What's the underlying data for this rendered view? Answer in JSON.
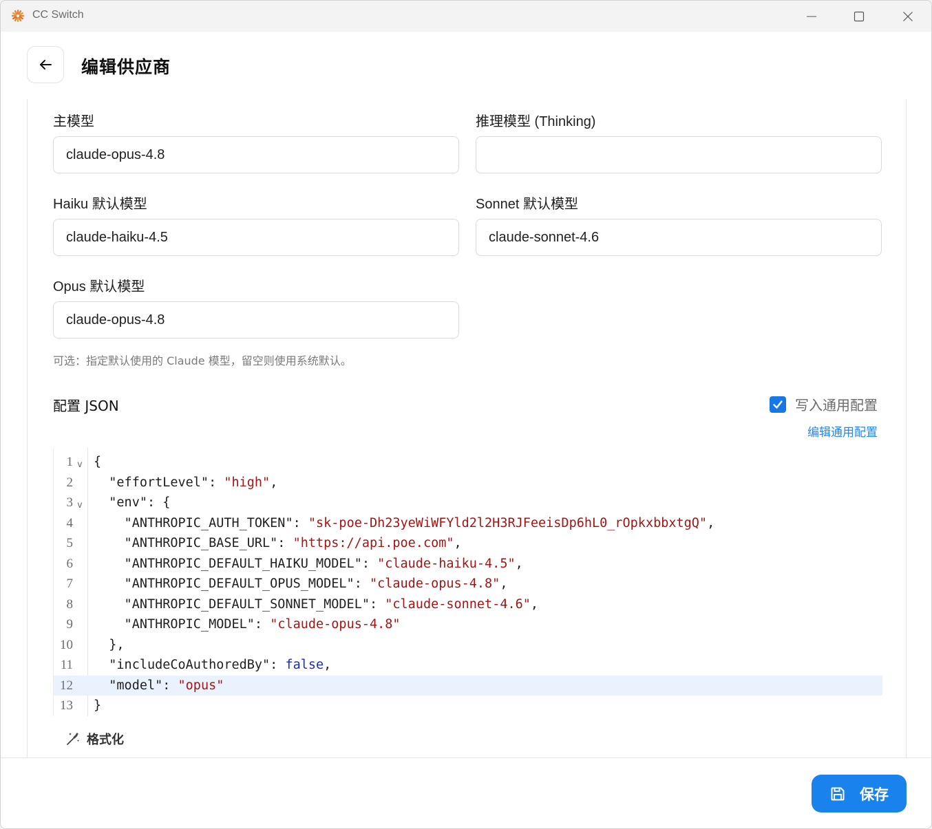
{
  "window": {
    "title": "CC Switch",
    "logo_icon": "cc-switch-logo",
    "accent": "#1a82ed"
  },
  "header": {
    "title": "编辑供应商",
    "back_icon": "arrow-left-icon"
  },
  "form": {
    "main_model": {
      "label": "主模型",
      "value": "claude-opus-4.8"
    },
    "thinking_model": {
      "label": "推理模型 (Thinking)",
      "value": ""
    },
    "haiku_model": {
      "label": "Haiku 默认模型",
      "value": "claude-haiku-4.5"
    },
    "sonnet_model": {
      "label": "Sonnet 默认模型",
      "value": "claude-sonnet-4.6"
    },
    "opus_model": {
      "label": "Opus 默认模型",
      "value": "claude-opus-4.8"
    },
    "hint": "可选：指定默认使用的 Claude 模型，留空则使用系统默认。"
  },
  "json_config": {
    "label": "配置 JSON",
    "write_common_label": "写入通用配置",
    "write_common_checked": true,
    "edit_common_link": "编辑通用配置",
    "format_label": "格式化",
    "lines": [
      {
        "n": "1",
        "tokens": [
          [
            "k",
            "{"
          ]
        ],
        "fold": true
      },
      {
        "n": "2",
        "tokens": [
          [
            "k",
            "  \"effortLevel\": "
          ],
          [
            "s",
            "\"high\""
          ],
          [
            "k",
            ","
          ]
        ]
      },
      {
        "n": "3",
        "tokens": [
          [
            "k",
            "  \"env\": {"
          ]
        ],
        "fold": true
      },
      {
        "n": "4",
        "tokens": [
          [
            "k",
            "    \"ANTHROPIC_AUTH_TOKEN\": "
          ],
          [
            "s",
            "\"sk-poe-Dh23yeWiWFYld2l2H3RJFeeisDp6hL0_rOpkxbbxtgQ\""
          ],
          [
            "k",
            ","
          ]
        ]
      },
      {
        "n": "5",
        "tokens": [
          [
            "k",
            "    \"ANTHROPIC_BASE_URL\": "
          ],
          [
            "s",
            "\"https://api.poe.com\""
          ],
          [
            "k",
            ","
          ]
        ]
      },
      {
        "n": "6",
        "tokens": [
          [
            "k",
            "    \"ANTHROPIC_DEFAULT_HAIKU_MODEL\": "
          ],
          [
            "s",
            "\"claude-haiku-4.5\""
          ],
          [
            "k",
            ","
          ]
        ]
      },
      {
        "n": "7",
        "tokens": [
          [
            "k",
            "    \"ANTHROPIC_DEFAULT_OPUS_MODEL\": "
          ],
          [
            "s",
            "\"claude-opus-4.8\""
          ],
          [
            "k",
            ","
          ]
        ]
      },
      {
        "n": "8",
        "tokens": [
          [
            "k",
            "    \"ANTHROPIC_DEFAULT_SONNET_MODEL\": "
          ],
          [
            "s",
            "\"claude-sonnet-4.6\""
          ],
          [
            "k",
            ","
          ]
        ]
      },
      {
        "n": "9",
        "tokens": [
          [
            "k",
            "    \"ANTHROPIC_MODEL\": "
          ],
          [
            "s",
            "\"claude-opus-4.8\""
          ]
        ]
      },
      {
        "n": "10",
        "tokens": [
          [
            "k",
            "  },"
          ]
        ]
      },
      {
        "n": "11",
        "tokens": [
          [
            "k",
            "  \"includeCoAuthoredBy\": "
          ],
          [
            "b",
            "false"
          ],
          [
            "k",
            ","
          ]
        ]
      },
      {
        "n": "12",
        "tokens": [
          [
            "k",
            "  \"model\": "
          ],
          [
            "s",
            "\"opus\""
          ]
        ],
        "active": true
      },
      {
        "n": "13",
        "tokens": [
          [
            "k",
            "}"
          ]
        ]
      }
    ]
  },
  "footer": {
    "save_label": "保存",
    "save_icon": "save-icon"
  }
}
